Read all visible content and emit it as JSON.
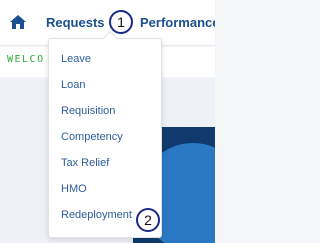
{
  "nav": {
    "home_icon": "home-icon",
    "requests_label": "Requests",
    "performance_label": "Performance"
  },
  "welcome": {
    "text": "WELCO"
  },
  "dropdown": {
    "items": [
      {
        "label": "Leave"
      },
      {
        "label": "Loan"
      },
      {
        "label": "Requisition"
      },
      {
        "label": "Competency"
      },
      {
        "label": "Tax Relief"
      },
      {
        "label": "HMO"
      },
      {
        "label": "Redeployment"
      }
    ]
  },
  "annotations": {
    "badge_1": "1",
    "badge_2": "2"
  },
  "colors": {
    "nav_text": "#1b4f8e",
    "menu_text": "#2f5d9a",
    "welcome_text": "#31a83d",
    "hero_dark": "#103a6d",
    "hero_circle": "#2a78c4",
    "badge_border": "#1b2a8a"
  }
}
